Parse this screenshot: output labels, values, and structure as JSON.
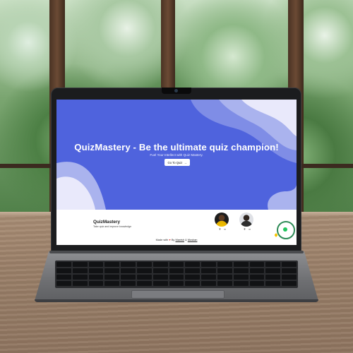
{
  "hero": {
    "title": "QuizMastery - Be the ultimate quiz champion!",
    "subtitle": "Fuel Your Intellect with Quiz Mastery.",
    "cta_label": "Go To Quiz",
    "cta_icon": "arrow-right-icon",
    "colors": {
      "primary": "#4f63dd",
      "wave_light": "#e9e9fb",
      "wave_mid": "#aab3ee"
    }
  },
  "footer": {
    "brand": "QuizMastery",
    "tagline": "Take quiz and improve knowledge",
    "made_prefix": "Made with",
    "made_by": "By",
    "author1": "Manish",
    "separator": "&",
    "author2": "Muskan"
  },
  "authors": [
    {
      "icons": [
        "github-icon",
        "linkedin-icon"
      ]
    },
    {
      "icons": [
        "github-icon",
        "linkedin-icon"
      ]
    }
  ]
}
